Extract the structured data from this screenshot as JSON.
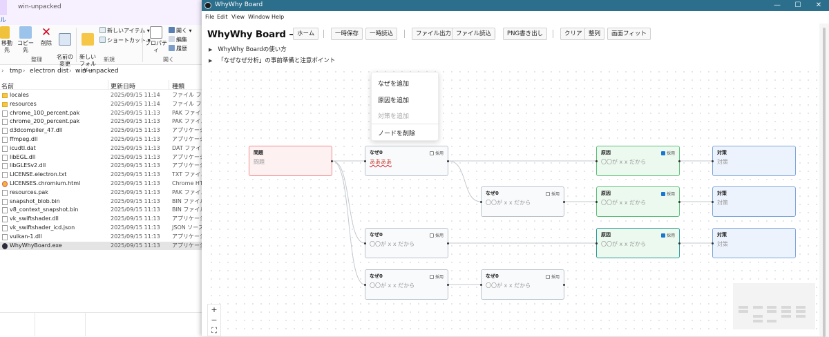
{
  "explorer": {
    "window_tab": "win-unpacked",
    "ribbon_tab_fragment": "ル",
    "ribbon": {
      "move_to": "移動先",
      "copy_to": "コピー先",
      "delete": "削除",
      "rename": "名前の\n変更",
      "new_folder": "新しい\nフォルダー",
      "new_item": "新しいアイテム ▾",
      "shortcut": "ショートカット ▾",
      "properties": "プロパティ",
      "open": "開く ▾",
      "edit": "編集",
      "history": "履歴",
      "group_organize": "整理",
      "group_new": "新規",
      "group_open": "開く"
    },
    "path": [
      "tmp",
      "electron",
      "dist",
      "win-unpacked"
    ],
    "columns": {
      "name": "名前",
      "date": "更新日時",
      "type": "種類"
    },
    "files": [
      {
        "name": "locales",
        "date": "2025/09/15 11:14",
        "type": "ファイル フォルダー",
        "icon": "folder"
      },
      {
        "name": "resources",
        "date": "2025/09/15 11:14",
        "type": "ファイル フォルダー",
        "icon": "folder"
      },
      {
        "name": "chrome_100_percent.pak",
        "date": "2025/09/15 11:13",
        "type": "PAK ファイル",
        "icon": "file"
      },
      {
        "name": "chrome_200_percent.pak",
        "date": "2025/09/15 11:13",
        "type": "PAK ファイル",
        "icon": "file"
      },
      {
        "name": "d3dcompiler_47.dll",
        "date": "2025/09/15 11:13",
        "type": "アプリケーション拡張",
        "icon": "file"
      },
      {
        "name": "ffmpeg.dll",
        "date": "2025/09/15 11:13",
        "type": "アプリケーション拡張",
        "icon": "file"
      },
      {
        "name": "icudtl.dat",
        "date": "2025/09/15 11:13",
        "type": "DAT ファイル",
        "icon": "file"
      },
      {
        "name": "libEGL.dll",
        "date": "2025/09/15 11:13",
        "type": "アプリケーション拡張",
        "icon": "file"
      },
      {
        "name": "libGLESv2.dll",
        "date": "2025/09/15 11:13",
        "type": "アプリケーション拡張",
        "icon": "file"
      },
      {
        "name": "LICENSE.electron.txt",
        "date": "2025/09/15 11:13",
        "type": "TXT ファイル",
        "icon": "file"
      },
      {
        "name": "LICENSES.chromium.html",
        "date": "2025/09/15 11:13",
        "type": "Chrome HTML",
        "icon": "chrome"
      },
      {
        "name": "resources.pak",
        "date": "2025/09/15 11:13",
        "type": "PAK ファイル",
        "icon": "file"
      },
      {
        "name": "snapshot_blob.bin",
        "date": "2025/09/15 11:13",
        "type": "BIN ファイル",
        "icon": "file"
      },
      {
        "name": "v8_context_snapshot.bin",
        "date": "2025/09/15 11:13",
        "type": "BIN ファイル",
        "icon": "file"
      },
      {
        "name": "vk_swiftshader.dll",
        "date": "2025/09/15 11:13",
        "type": "アプリケーション拡張",
        "icon": "file"
      },
      {
        "name": "vk_swiftshader_icd.json",
        "date": "2025/09/15 11:13",
        "type": "JSON ソース ファイル",
        "icon": "file"
      },
      {
        "name": "vulkan-1.dll",
        "date": "2025/09/15 11:13",
        "type": "アプリケーション拡張",
        "icon": "file"
      },
      {
        "name": "WhyWhyBoard.exe",
        "date": "2025/09/15 11:13",
        "type": "アプリケーション",
        "icon": "exe",
        "selected": true
      }
    ]
  },
  "app": {
    "window_title": "WhyWhy Board",
    "window_controls": {
      "minimize": "—",
      "maximize": "☐",
      "close": "✕"
    },
    "menu": [
      "File",
      "Edit",
      "View",
      "Window",
      "Help"
    ],
    "title": "WhyWhy Board – dev",
    "toolbar": {
      "home": "ホーム",
      "temp_save": "一時保存",
      "temp_load": "一時読込",
      "file_export": "ファイル出力",
      "file_import": "ファイル読込",
      "png_export": "PNG書き出し",
      "clear": "クリア",
      "arrange": "整列",
      "fit": "画面フィット"
    },
    "help_sections": [
      "WhyWhy Boardの使い方",
      "「なぜなぜ分析」の事前準備と注意ポイント"
    ],
    "context_menu": {
      "add_why": "なぜを追加",
      "add_cause": "原因を追加",
      "add_counter": "対策を追加",
      "delete_node": "ノードを削除"
    },
    "nodes": {
      "problem": {
        "label": "問題",
        "text": "問題"
      },
      "why_1": {
        "label": "なぜ0",
        "text": "ああああ",
        "adopt": "採用",
        "checked": false
      },
      "why_2": {
        "label": "なぜ0",
        "text": "〇〇が x x だから",
        "adopt": "採用",
        "checked": false
      },
      "why_3": {
        "label": "なぜ0",
        "text": "〇〇が x x だから",
        "adopt": "採用",
        "checked": false
      },
      "why_4": {
        "label": "なぜ0",
        "text": "〇〇が x x だから",
        "adopt": "採用",
        "checked": false
      },
      "why_5": {
        "label": "なぜ0",
        "text": "〇〇が x x だから",
        "adopt": "採用",
        "checked": false
      },
      "cause_1": {
        "label": "原因",
        "text": "〇〇が x x だから",
        "adopt": "採用",
        "checked": true
      },
      "cause_2": {
        "label": "原因",
        "text": "〇〇が x x だから",
        "adopt": "採用",
        "checked": true
      },
      "cause_3": {
        "label": "原因",
        "text": "〇〇が x x だから",
        "adopt": "採用",
        "checked": true
      },
      "counter_1": {
        "label": "対策",
        "text": "対策"
      },
      "counter_2": {
        "label": "対策",
        "text": "対策"
      },
      "counter_3": {
        "label": "対策",
        "text": "対策"
      }
    },
    "zoom": {
      "in": "+",
      "out": "−",
      "fit": "⛶"
    },
    "colors": {
      "titlebar": "#2b6f8c",
      "problem_border": "#f28b8b",
      "cause_border": "#5ebd7a",
      "counter_border": "#7fa6dc",
      "checkbox_checked": "#1976d2"
    }
  }
}
